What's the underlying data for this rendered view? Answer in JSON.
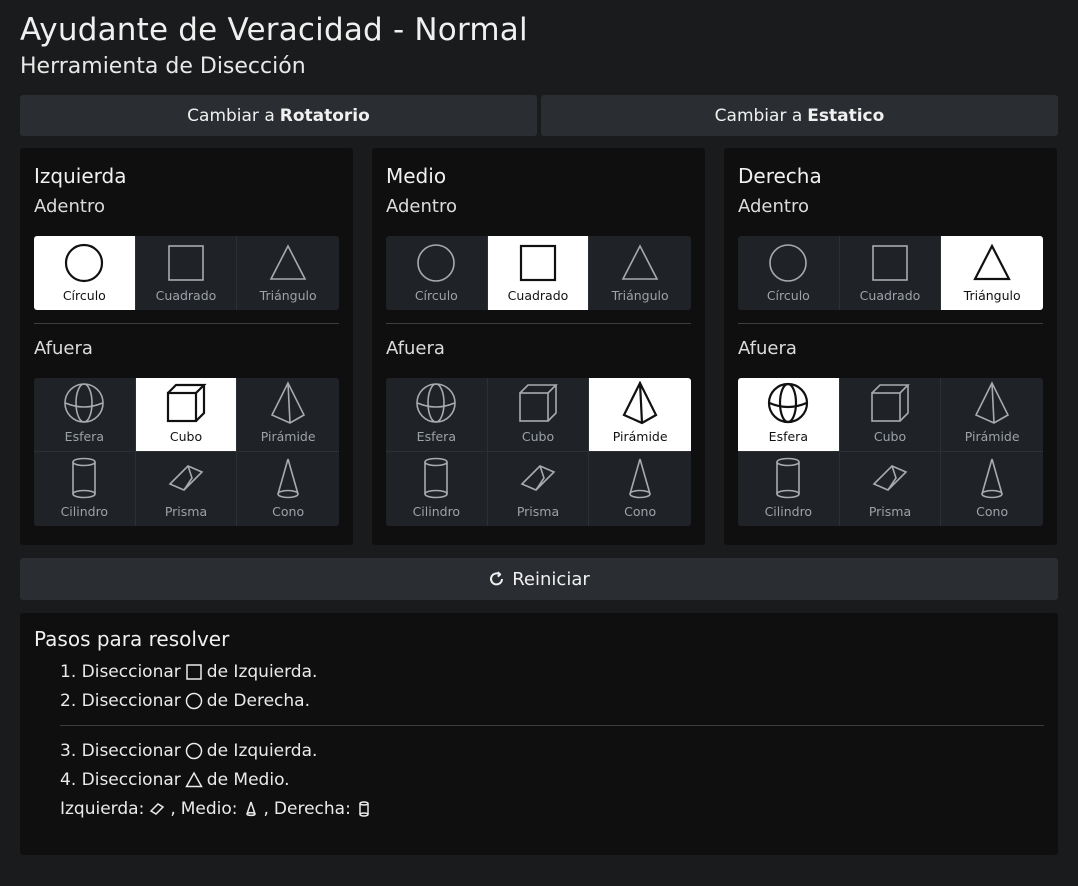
{
  "header": {
    "title": "Ayudante de Veracidad - Normal",
    "subtitle": "Herramienta de Disección"
  },
  "switches": [
    {
      "prefix": "Cambiar a",
      "mode": "Rotatorio"
    },
    {
      "prefix": "Cambiar a",
      "mode": "Estatico"
    }
  ],
  "panels": [
    {
      "name": "Izquierda",
      "inside_label": "Adentro",
      "outside_label": "Afuera"
    },
    {
      "name": "Medio",
      "inside_label": "Adentro",
      "outside_label": "Afuera"
    },
    {
      "name": "Derecha",
      "inside_label": "Adentro",
      "outside_label": "Afuera"
    }
  ],
  "inside_shapes": [
    "Círculo",
    "Cuadrado",
    "Triángulo"
  ],
  "outside_shapes": [
    "Esfera",
    "Cubo",
    "Pirámide",
    "Cilindro",
    "Prisma",
    "Cono"
  ],
  "selected": {
    "inside": [
      "Círculo",
      "Cuadrado",
      "Triángulo"
    ],
    "outside": [
      "Cubo",
      "Pirámide",
      "Esfera"
    ]
  },
  "reset_label": "Reiniciar",
  "steps": {
    "title": "Pasos para resolver",
    "items": [
      {
        "num": "1.",
        "verb": "Diseccionar",
        "icon": "square-icon",
        "suffix": "de Izquierda."
      },
      {
        "num": "2.",
        "verb": "Diseccionar",
        "icon": "circle-icon",
        "suffix": "de Derecha."
      },
      {
        "num": "3.",
        "verb": "Diseccionar",
        "icon": "circle-icon",
        "suffix": "de Izquierda."
      },
      {
        "num": "4.",
        "verb": "Diseccionar",
        "icon": "triangle-icon",
        "suffix": "de Medio."
      }
    ],
    "final": {
      "left_label": "Izquierda:",
      "left_icon": "prism-icon",
      "mid_label": "Medio:",
      "mid_icon": "cone-icon",
      "right_label": "Derecha:",
      "right_icon": "cylinder-icon"
    }
  }
}
